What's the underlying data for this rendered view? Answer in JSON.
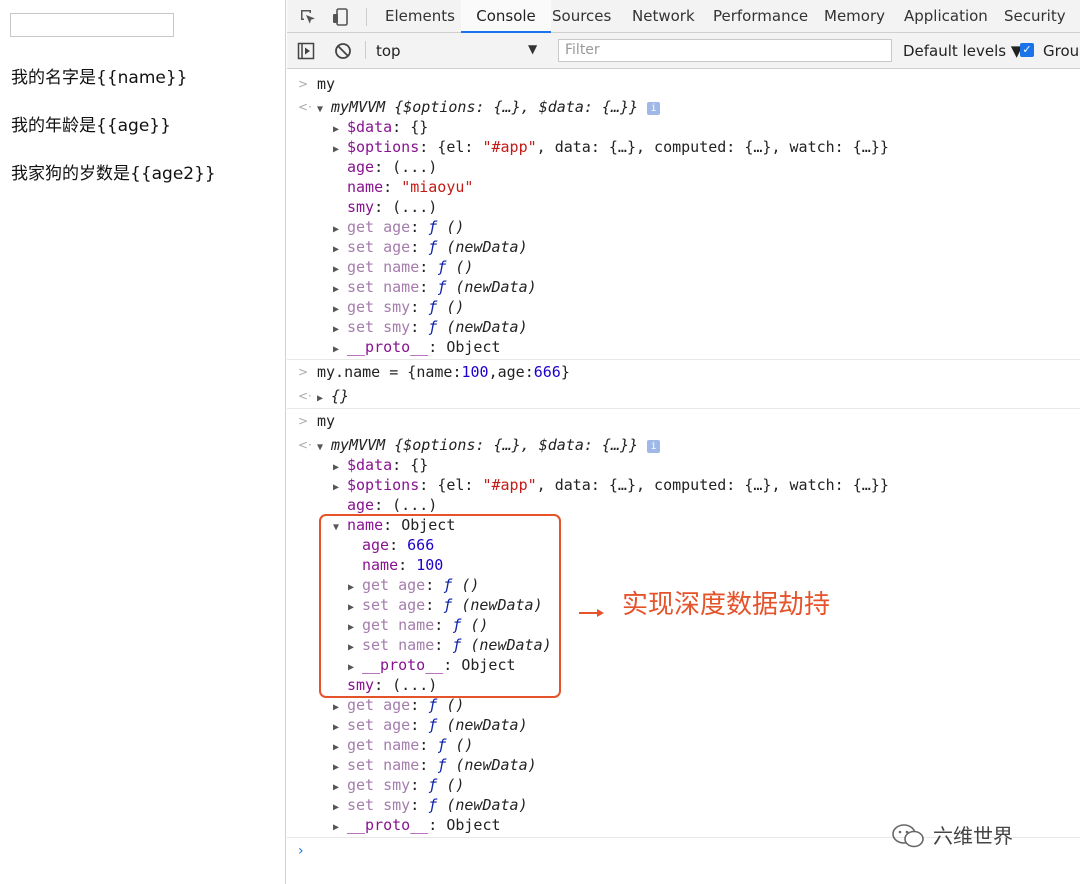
{
  "page": {
    "input_value": "",
    "line_name": "我的名字是{{name}}",
    "line_age": "我的年龄是{{age}}",
    "line_dog": "我家狗的岁数是{{age2}}"
  },
  "devtools": {
    "tabs": [
      "Elements",
      "Console",
      "Sources",
      "Network",
      "Performance",
      "Memory",
      "Application",
      "Security"
    ],
    "active_tab": "Console",
    "context": "top",
    "filter_placeholder": "Filter",
    "levels": "Default levels ▼",
    "group": "Group"
  },
  "console": {
    "cmd1": "my",
    "obj_label": "myMVVM",
    "obj_preview": "{$options: {…}, $data: {…}}",
    "data_prop": "$data",
    "data_val": "{}",
    "options_prop": "$options",
    "options_open": "{el: ",
    "options_el": "\"#app\"",
    "options_rest": ", data: {…}, computed: {…}, watch: {…}}",
    "age_prop": "age",
    "lazy": "(...)",
    "name_prop": "name",
    "name_val": "\"miaoyu\"",
    "smy_prop": "smy",
    "get_age": "get age",
    "set_age": "set age",
    "get_name": "get name",
    "set_name": "set name",
    "get_smy": "get smy",
    "set_smy": "set smy",
    "fn_sym": "ƒ",
    "fn_noargs": "()",
    "fn_args": "(newData)",
    "proto_prop": "__proto__",
    "object_word": "Object",
    "cmd2_prefix": "my.name = {name:",
    "cmd2_num1": "100",
    "cmd2_mid": ",age:",
    "cmd2_num2": "666",
    "cmd2_suffix": "}",
    "result2": "{}",
    "cmd3": "my",
    "nested_age_val": "666",
    "nested_name_val": "100"
  },
  "annotation": "实现深度数据劫持",
  "watermark": "六维世界",
  "colors": {
    "accent": "#1a73e8",
    "annotation": "#e5532b",
    "property": "#881391",
    "string": "#c41a16",
    "number": "#1c00cf"
  }
}
